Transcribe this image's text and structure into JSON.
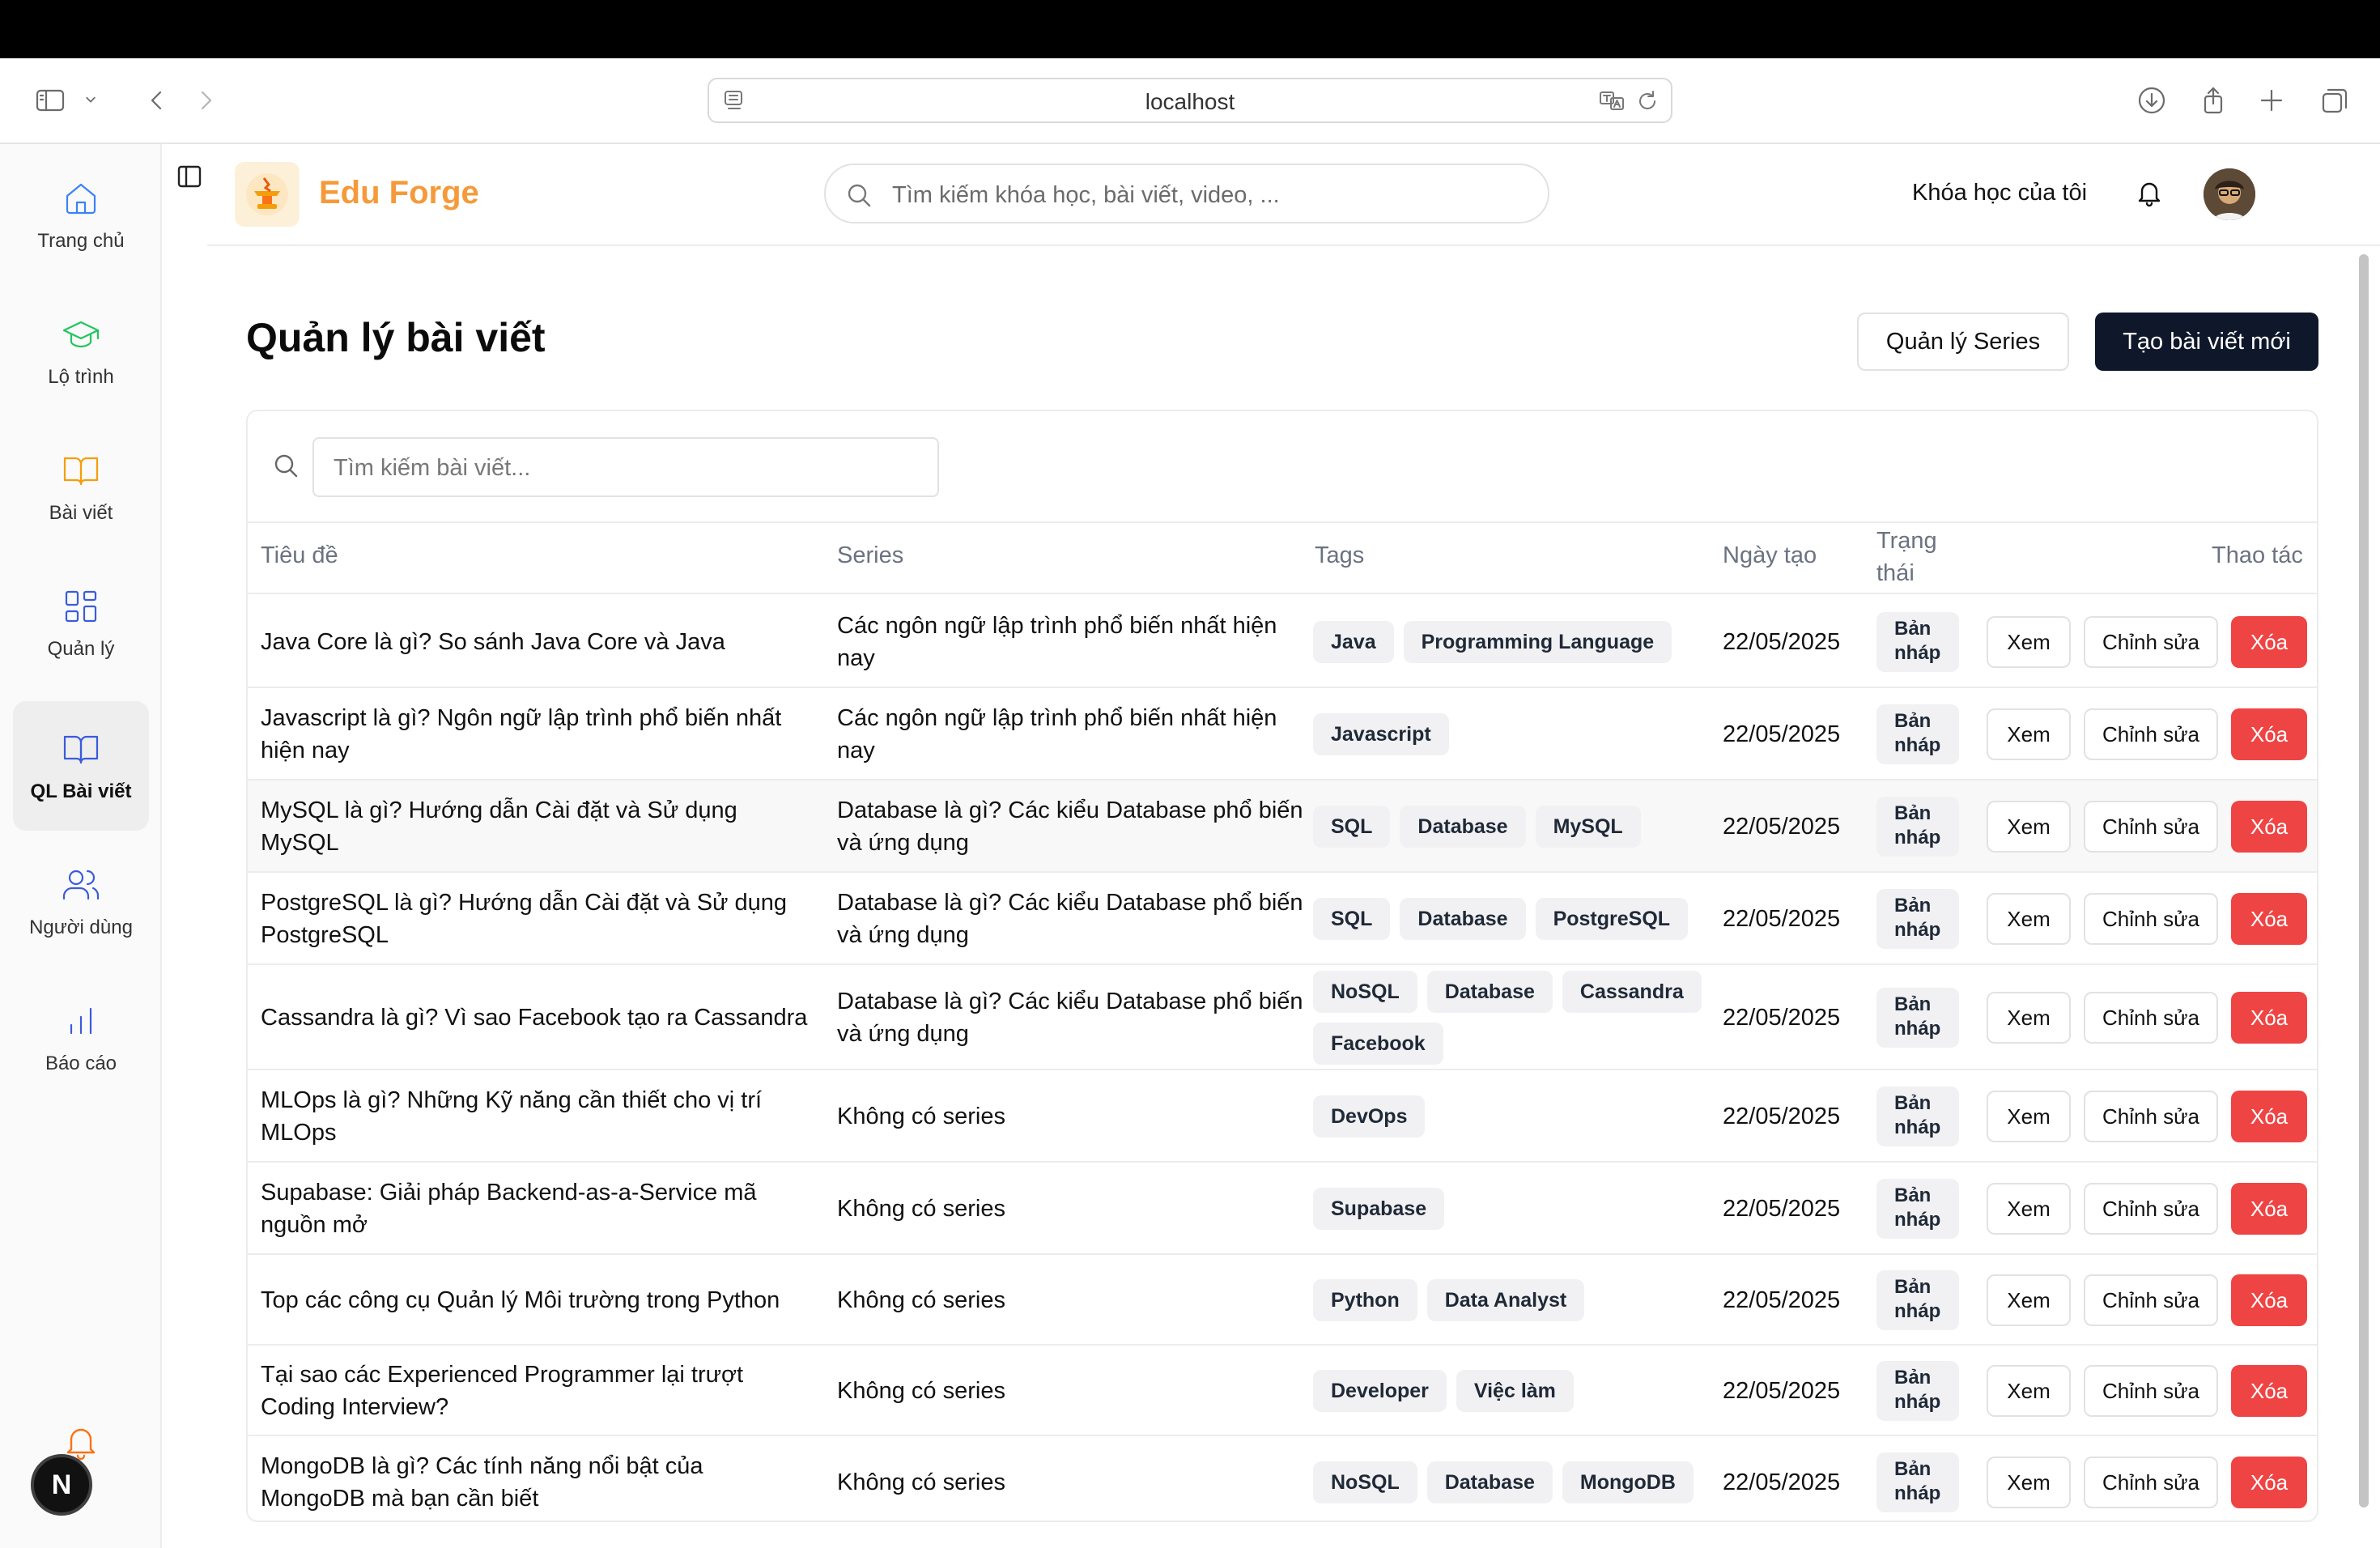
{
  "browser": {
    "url": "localhost"
  },
  "sidebar": {
    "items": [
      {
        "label": "Trang chủ",
        "icon": "home-icon",
        "color": "#3b82f6"
      },
      {
        "label": "Lộ trình",
        "icon": "graduation-cap-icon",
        "color": "#22c55e"
      },
      {
        "label": "Bài viết",
        "icon": "book-open-icon",
        "color": "#f59e0b"
      },
      {
        "label": "Quản lý",
        "icon": "grid-icon",
        "color": "#3b5bdb"
      },
      {
        "label": "QL Bài viết",
        "icon": "book-open-icon",
        "color": "#3b5bdb"
      },
      {
        "label": "Người dùng",
        "icon": "users-icon",
        "color": "#3b5bdb"
      },
      {
        "label": "Báo cáo",
        "icon": "bar-chart-icon",
        "color": "#3b5bdb"
      }
    ],
    "active": "QL Bài viết",
    "next_badge": "N"
  },
  "header": {
    "brand": "Edu Forge",
    "search_placeholder": "Tìm kiếm khóa học, bài viết, video, ...",
    "my_courses": "Khóa học của tôi"
  },
  "page": {
    "title": "Quản lý bài viết",
    "series_button": "Quản lý Series",
    "new_button": "Tạo bài viết mới",
    "search_placeholder": "Tìm kiếm bài viết..."
  },
  "table": {
    "headers": {
      "title": "Tiêu đề",
      "series": "Series",
      "tags": "Tags",
      "created": "Ngày tạo",
      "status": "Trạng thái",
      "actions": "Thao tác"
    },
    "actions": {
      "view": "Xem",
      "edit": "Chỉnh sửa",
      "delete": "Xóa"
    },
    "rows": [
      {
        "title": "Java Core là gì? So sánh Java Core và Java",
        "series": "Các ngôn ngữ lập trình phổ biến nhất hiện nay",
        "tags": [
          "Java",
          "Programming Language"
        ],
        "date": "22/05/2025",
        "status": "Bản nháp"
      },
      {
        "title": "Javascript là gì? Ngôn ngữ lập trình phổ biến nhất hiện nay",
        "series": "Các ngôn ngữ lập trình phổ biến nhất hiện nay",
        "tags": [
          "Javascript"
        ],
        "date": "22/05/2025",
        "status": "Bản nháp"
      },
      {
        "title": "MySQL là gì? Hướng dẫn Cài đặt và Sử dụng MySQL",
        "series": "Database là gì? Các kiểu Database phổ biến và ứng dụng",
        "tags": [
          "SQL",
          "Database",
          "MySQL"
        ],
        "date": "22/05/2025",
        "status": "Bản nháp"
      },
      {
        "title": "PostgreSQL là gì? Hướng dẫn Cài đặt và Sử dụng PostgreSQL",
        "series": "Database là gì? Các kiểu Database phổ biến và ứng dụng",
        "tags": [
          "SQL",
          "Database",
          "PostgreSQL"
        ],
        "date": "22/05/2025",
        "status": "Bản nháp"
      },
      {
        "title": "Cassandra là gì? Vì sao Facebook tạo ra Cassandra",
        "series": "Database là gì? Các kiểu Database phổ biến và ứng dụng",
        "tags": [
          "NoSQL",
          "Database",
          "Cassandra",
          "Facebook"
        ],
        "date": "22/05/2025",
        "status": "Bản nháp"
      },
      {
        "title": "MLOps là gì? Những Kỹ năng cần thiết cho vị trí MLOps",
        "series": "Không có series",
        "tags": [
          "DevOps"
        ],
        "date": "22/05/2025",
        "status": "Bản nháp"
      },
      {
        "title": "Supabase: Giải pháp Backend-as-a-Service mã nguồn mở",
        "series": "Không có series",
        "tags": [
          "Supabase"
        ],
        "date": "22/05/2025",
        "status": "Bản nháp"
      },
      {
        "title": "Top các công cụ Quản lý Môi trường trong Python",
        "series": "Không có series",
        "tags": [
          "Python",
          "Data Analyst"
        ],
        "date": "22/05/2025",
        "status": "Bản nháp"
      },
      {
        "title": "Tại sao các Experienced Programmer lại trượt Coding Interview?",
        "series": "Không có series",
        "tags": [
          "Developer",
          "Việc làm"
        ],
        "date": "22/05/2025",
        "status": "Bản nháp"
      },
      {
        "title": "MongoDB là gì? Các tính năng nổi bật của MongoDB mà bạn cần biết",
        "series": "Không có series",
        "tags": [
          "NoSQL",
          "Database",
          "MongoDB"
        ],
        "date": "22/05/2025",
        "status": "Bản nháp"
      }
    ]
  },
  "colors": {
    "brand": "#f59a3a",
    "primary_button": "#0f172a",
    "delete_button": "#ef4444"
  }
}
